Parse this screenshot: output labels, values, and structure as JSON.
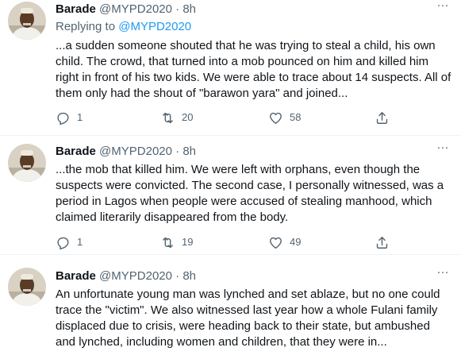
{
  "tweets": [
    {
      "author_name": "Barade",
      "handle": "@MYPD2020",
      "separator": "·",
      "time": "8h",
      "replying_prefix": "Replying to",
      "replying_handle": "@MYPD2020",
      "text": "...a sudden someone shouted that he was trying to steal a child, his own child. The crowd, that turned into a mob pounced on him and killed him right in front of his two kids. We were able to trace about 14 suspects. All of them only had the shout of \"barawon yara\" and joined...",
      "reply_count": "1",
      "retweet_count": "20",
      "like_count": "58",
      "more_label": "···"
    },
    {
      "author_name": "Barade",
      "handle": "@MYPD2020",
      "separator": "·",
      "time": "8h",
      "text": "...the mob that killed him. We were left with orphans, even though the suspects were convicted. The second case, I personally witnessed, was a period in Lagos when people were accused of stealing manhood, which claimed literarily disappeared from the body.",
      "reply_count": "1",
      "retweet_count": "19",
      "like_count": "49",
      "more_label": "···"
    },
    {
      "author_name": "Barade",
      "handle": "@MYPD2020",
      "separator": "·",
      "time": "8h",
      "text": "An unfortunate young man was lynched and set ablaze, but no one could trace the \"victim\". We also witnessed last year how a whole Fulani family displaced due to crisis, were heading back to their state, but ambushed and lynched, including women and children, that they were in...",
      "more_label": "···"
    }
  ],
  "icons": {
    "reply": "reply-icon",
    "retweet": "retweet-icon",
    "like": "heart-icon",
    "share": "share-icon",
    "more": "more-icon"
  },
  "colors": {
    "text": "#0f1419",
    "muted": "#536471",
    "link": "#1d9bf0",
    "divider": "#eff3f4"
  }
}
